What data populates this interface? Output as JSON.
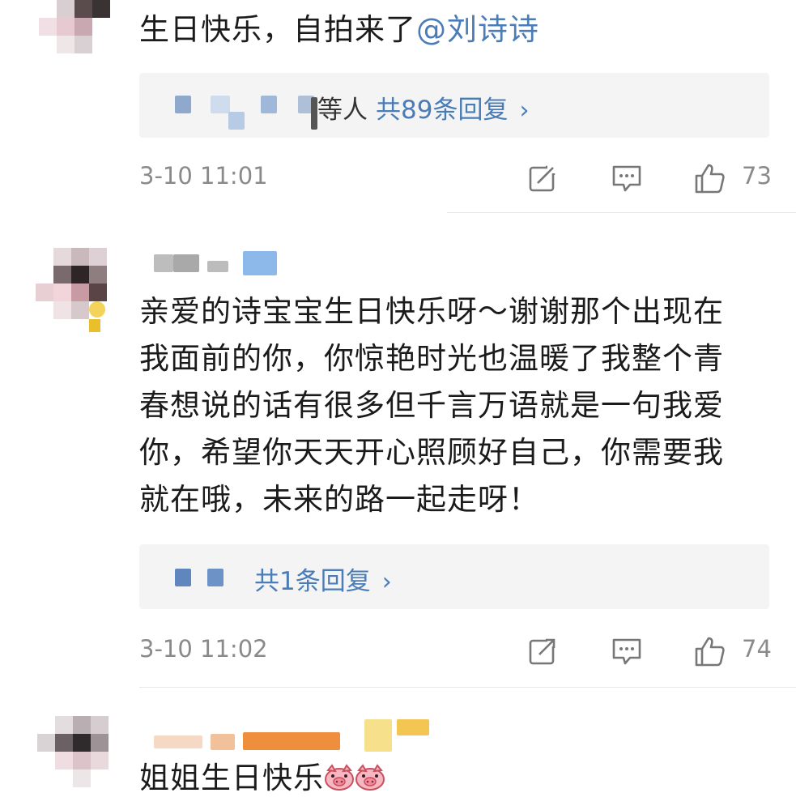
{
  "comments": [
    {
      "text_prefix": "生日快乐，自拍来了",
      "mention": "@刘诗诗",
      "reply_extra": "等人",
      "reply_link": "共89条回复",
      "time": "3-10 11:01",
      "likes": "73"
    },
    {
      "text_lines": [
        "亲爱的诗宝宝生日快乐呀～谢谢那个出现在",
        "我面前的你，你惊艳时光也温暖了我整个青",
        "春想说的话有很多但千言万语就是一句我爱",
        "你，希望你天天开心照顾好自己，你需要我",
        "就在哦，未来的路一起走呀！"
      ],
      "reply_link": "共1条回复",
      "time": "3-10 11:02",
      "likes": "74"
    },
    {
      "text": "姐姐生日快乐"
    }
  ],
  "icons": {
    "share": "share-icon",
    "comment": "comment-icon",
    "like": "thumbs-up-icon",
    "chevron": "chevron-right-icon"
  },
  "colors": {
    "link": "#4a7cb8",
    "meta": "#8a8a8a",
    "reply_bg": "#f4f4f4"
  }
}
